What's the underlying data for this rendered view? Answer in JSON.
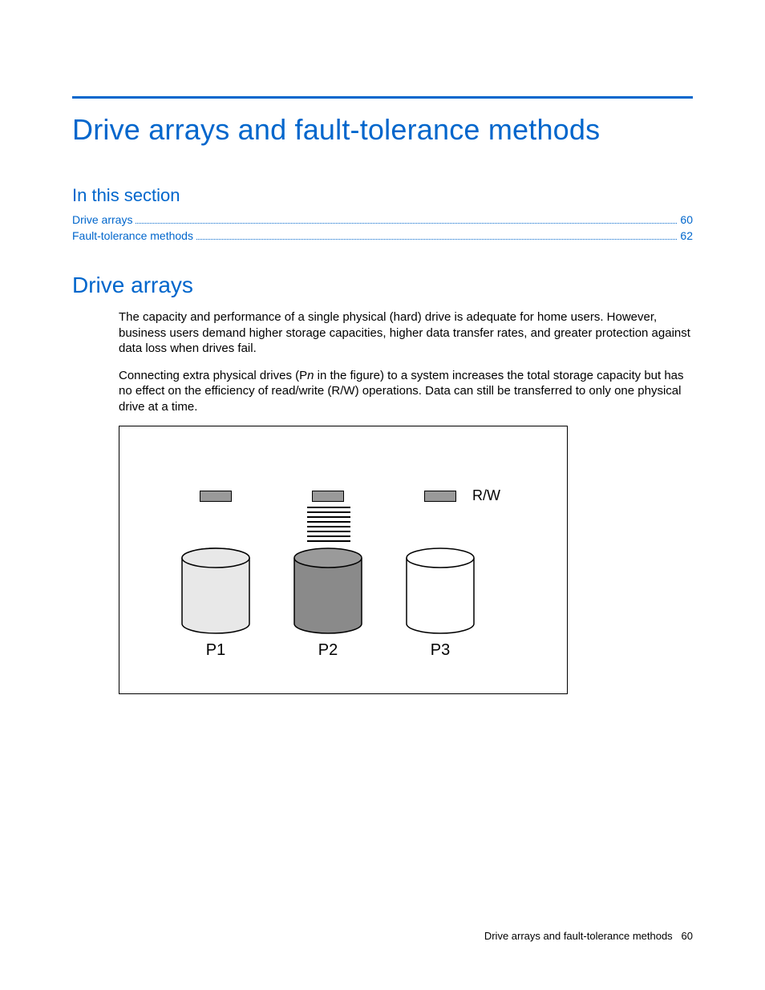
{
  "title": "Drive arrays and fault-tolerance methods",
  "section_heading": "In this section",
  "toc": [
    {
      "label": "Drive arrays",
      "page": "60"
    },
    {
      "label": "Fault-tolerance methods",
      "page": "62"
    }
  ],
  "h2": "Drive arrays",
  "para1": "The capacity and performance of a single physical (hard) drive is adequate for home users. However, business users demand higher storage capacities, higher data transfer rates, and greater protection against data loss when drives fail.",
  "para2_a": "Connecting extra physical drives (P",
  "para2_n": "n",
  "para2_b": " in the figure) to a system increases the total storage capacity but has no effect on the efficiency of read/write (R/W) operations. Data can still be transferred to only one physical drive at a time.",
  "figure": {
    "rw_label": "R/W",
    "p1": "P1",
    "p2": "P2",
    "p3": "P3"
  },
  "footer_label": "Drive arrays and fault-tolerance methods",
  "footer_page": "60"
}
